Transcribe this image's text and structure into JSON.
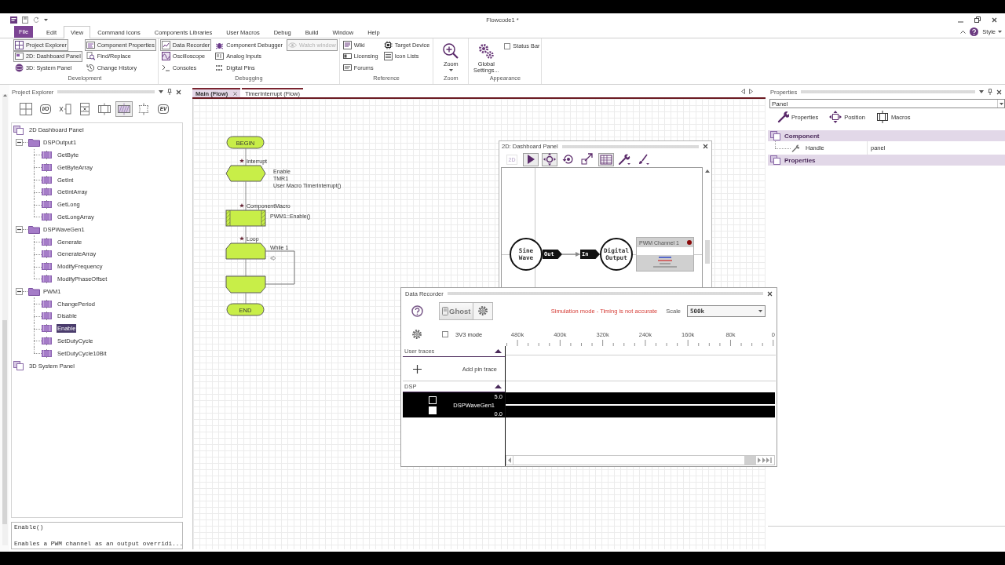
{
  "title_bar": {
    "title": "Flowcode1 *"
  },
  "menu_tabs": [
    {
      "label": "File",
      "kind": "backstage",
      "selected": false
    },
    {
      "label": "Edit",
      "kind": "tab",
      "selected": false
    },
    {
      "label": "View",
      "kind": "tab",
      "selected": true
    },
    {
      "label": "Command Icons",
      "kind": "tab",
      "selected": false
    },
    {
      "label": "Components Libraries",
      "kind": "tab",
      "selected": false
    },
    {
      "label": "User Macros",
      "kind": "tab",
      "selected": false
    },
    {
      "label": "Debug",
      "kind": "tab",
      "selected": false
    },
    {
      "label": "Build",
      "kind": "tab",
      "selected": false
    },
    {
      "label": "Window",
      "kind": "tab",
      "selected": false
    },
    {
      "label": "Help",
      "kind": "tab",
      "selected": false
    }
  ],
  "ribbon_options": {
    "label": "Style"
  },
  "ribbon_groups": [
    {
      "name": "Development",
      "kind": "list",
      "columns": [
        [
          {
            "label": "Project Explorer",
            "selected": true,
            "disabled": false
          },
          {
            "label": "2D: Dashboard Panel",
            "selected": true,
            "disabled": false
          },
          {
            "label": "3D: System Panel",
            "selected": false,
            "disabled": false
          }
        ],
        [
          {
            "label": "Component Properties",
            "selected": true,
            "disabled": false
          },
          {
            "label": "Find/Replace",
            "selected": false,
            "disabled": false
          },
          {
            "label": "Change History",
            "selected": false,
            "disabled": false
          }
        ]
      ]
    },
    {
      "name": "Debugging",
      "kind": "list",
      "columns": [
        [
          {
            "label": "Data Recorder",
            "selected": true,
            "disabled": false
          },
          {
            "label": "Oscilloscope",
            "selected": false,
            "disabled": false
          },
          {
            "label": "Consoles",
            "selected": false,
            "disabled": false
          }
        ],
        [
          {
            "label": "Component Debugger",
            "selected": false,
            "disabled": false
          },
          {
            "label": "Analog Inputs",
            "selected": false,
            "disabled": false
          },
          {
            "label": "Digital Pins",
            "selected": false,
            "disabled": false
          }
        ],
        [
          {
            "label": "Watch window",
            "selected": true,
            "disabled": true
          }
        ]
      ]
    },
    {
      "name": "Reference",
      "kind": "list",
      "columns": [
        [
          {
            "label": "Wiki",
            "selected": false,
            "disabled": false
          },
          {
            "label": "Licensing",
            "selected": false,
            "disabled": false
          },
          {
            "label": "Forums",
            "selected": false,
            "disabled": false
          }
        ],
        [
          {
            "label": "Target Device",
            "selected": false,
            "disabled": false
          },
          {
            "label": "Icon Lists",
            "selected": false,
            "disabled": false
          }
        ]
      ]
    },
    {
      "name": "Zoom",
      "kind": "large",
      "buttons": [
        {
          "label": "Zoom",
          "dropdown": true
        }
      ]
    },
    {
      "name": "Appearance",
      "kind": "large",
      "buttons": [
        {
          "label": "Global Settings...",
          "dropdown": false
        }
      ],
      "checkboxes": [
        {
          "label": "Status Bar",
          "checked": false
        }
      ]
    }
  ],
  "project_explorer": {
    "title": "Project Explorer",
    "toolbar": [
      {
        "selected": false
      },
      {
        "label": "I/O",
        "selected": false
      },
      {
        "selected": false
      },
      {
        "selected": false
      },
      {
        "selected": false
      },
      {
        "selected": true
      },
      {
        "selected": false
      },
      {
        "label": "EV",
        "selected": false
      }
    ],
    "tree": [
      {
        "label": "2D Dashboard Panel",
        "kind": "panel",
        "selected": false,
        "children": [
          {
            "label": "DSPOutput1",
            "kind": "component",
            "expanded": true,
            "selected": false,
            "children": [
              {
                "label": "GetByte",
                "kind": "macro",
                "selected": false
              },
              {
                "label": "GetByteArray",
                "kind": "macro",
                "selected": false
              },
              {
                "label": "GetInt",
                "kind": "macro",
                "selected": false
              },
              {
                "label": "GetIntArray",
                "kind": "macro",
                "selected": false
              },
              {
                "label": "GetLong",
                "kind": "macro",
                "selected": false
              },
              {
                "label": "GetLongArray",
                "kind": "macro",
                "selected": false
              }
            ]
          },
          {
            "label": "DSPWaveGen1",
            "kind": "component",
            "expanded": true,
            "selected": false,
            "children": [
              {
                "label": "Generate",
                "kind": "macro",
                "selected": false
              },
              {
                "label": "GenerateArray",
                "kind": "macro",
                "selected": false
              },
              {
                "label": "ModifyFrequency",
                "kind": "macro",
                "selected": false
              },
              {
                "label": "ModifyPhaseOffset",
                "kind": "macro",
                "selected": false
              }
            ]
          },
          {
            "label": "PWM1",
            "kind": "component",
            "expanded": true,
            "selected": false,
            "children": [
              {
                "label": "ChangePeriod",
                "kind": "macro",
                "selected": false
              },
              {
                "label": "Disable",
                "kind": "macro",
                "selected": false
              },
              {
                "label": "Enable",
                "kind": "macro",
                "selected": true
              },
              {
                "label": "SetDutyCycle",
                "kind": "macro",
                "selected": false
              },
              {
                "label": "SetDutyCycle10Bit",
                "kind": "macro",
                "selected": false
              }
            ]
          }
        ]
      },
      {
        "label": "3D System Panel",
        "kind": "panel",
        "selected": false
      }
    ],
    "description": {
      "signature": "Enable()",
      "text": "Enables a PWM channel as an output overridi..."
    }
  },
  "flowchart": {
    "tabs": [
      {
        "label": "Main (Flow)",
        "selected": true
      },
      {
        "label": "TimerInterrupt (Flow)",
        "selected": false
      }
    ],
    "nodes": [
      {
        "kind": "terminal",
        "label": "BEGIN"
      },
      {
        "kind": "interrupt",
        "title": "Interrupt",
        "lines": [
          "Enable",
          "TMR1",
          "User Macro TimerInterrupt()"
        ]
      },
      {
        "kind": "macro",
        "title": "ComponentMacro",
        "lines": [
          "PWM1::Enable()"
        ]
      },
      {
        "kind": "loop",
        "title": "Loop",
        "lines": [
          "While 1"
        ]
      },
      {
        "kind": "loop_end"
      },
      {
        "kind": "terminal",
        "label": "END"
      }
    ]
  },
  "dashboard_panel": {
    "title": "2D: Dashboard Panel",
    "toolbar": [
      {
        "label": "2D",
        "selected": false,
        "disabled": true
      },
      {
        "selected": true,
        "disabled": false
      },
      {
        "selected": true,
        "disabled": false
      },
      {
        "selected": false,
        "disabled": false
      },
      {
        "selected": false,
        "disabled": false
      },
      {
        "selected": true,
        "disabled": false
      },
      {
        "selected": false,
        "disabled": false
      },
      {
        "selected": false,
        "disabled": false
      }
    ],
    "components": [
      {
        "label": "Sine Wave",
        "pin": "Out"
      },
      {
        "label": "Digital Output",
        "pin": "In"
      }
    ],
    "indicator": {
      "title": "PWM Channel 1",
      "led_on": true
    }
  },
  "data_recorder": {
    "title": "Data Recorder",
    "ghost_label": "Ghost",
    "warning": "Simulation mode - Timing is not accurate",
    "scale_label": "Scale",
    "scale_value": "500k",
    "mode": {
      "label": "3V3 mode",
      "checked": false
    },
    "axis_labels": [
      "480k",
      "400k",
      "320k",
      "240k",
      "160k",
      "80k",
      "0"
    ],
    "user_traces": {
      "title": "User traces",
      "expanded": true,
      "add_label": "Add pin trace"
    },
    "dsp": {
      "title": "DSP",
      "expanded": true,
      "traces": [
        {
          "name": "DSPWaveGen1",
          "max": "5.0",
          "min": "0.0",
          "checked": false,
          "color": "#ffffff"
        }
      ]
    }
  },
  "properties_panel": {
    "title": "Properties",
    "selector": "Panel",
    "tabs": [
      {
        "label": "Properties",
        "selected": false
      },
      {
        "label": "Position",
        "selected": false
      },
      {
        "label": "Macros",
        "selected": false
      }
    ],
    "sections": [
      {
        "title": "Component",
        "rows": [
          {
            "name": "Handle",
            "value": "panel"
          }
        ]
      },
      {
        "title": "Properties"
      }
    ]
  }
}
